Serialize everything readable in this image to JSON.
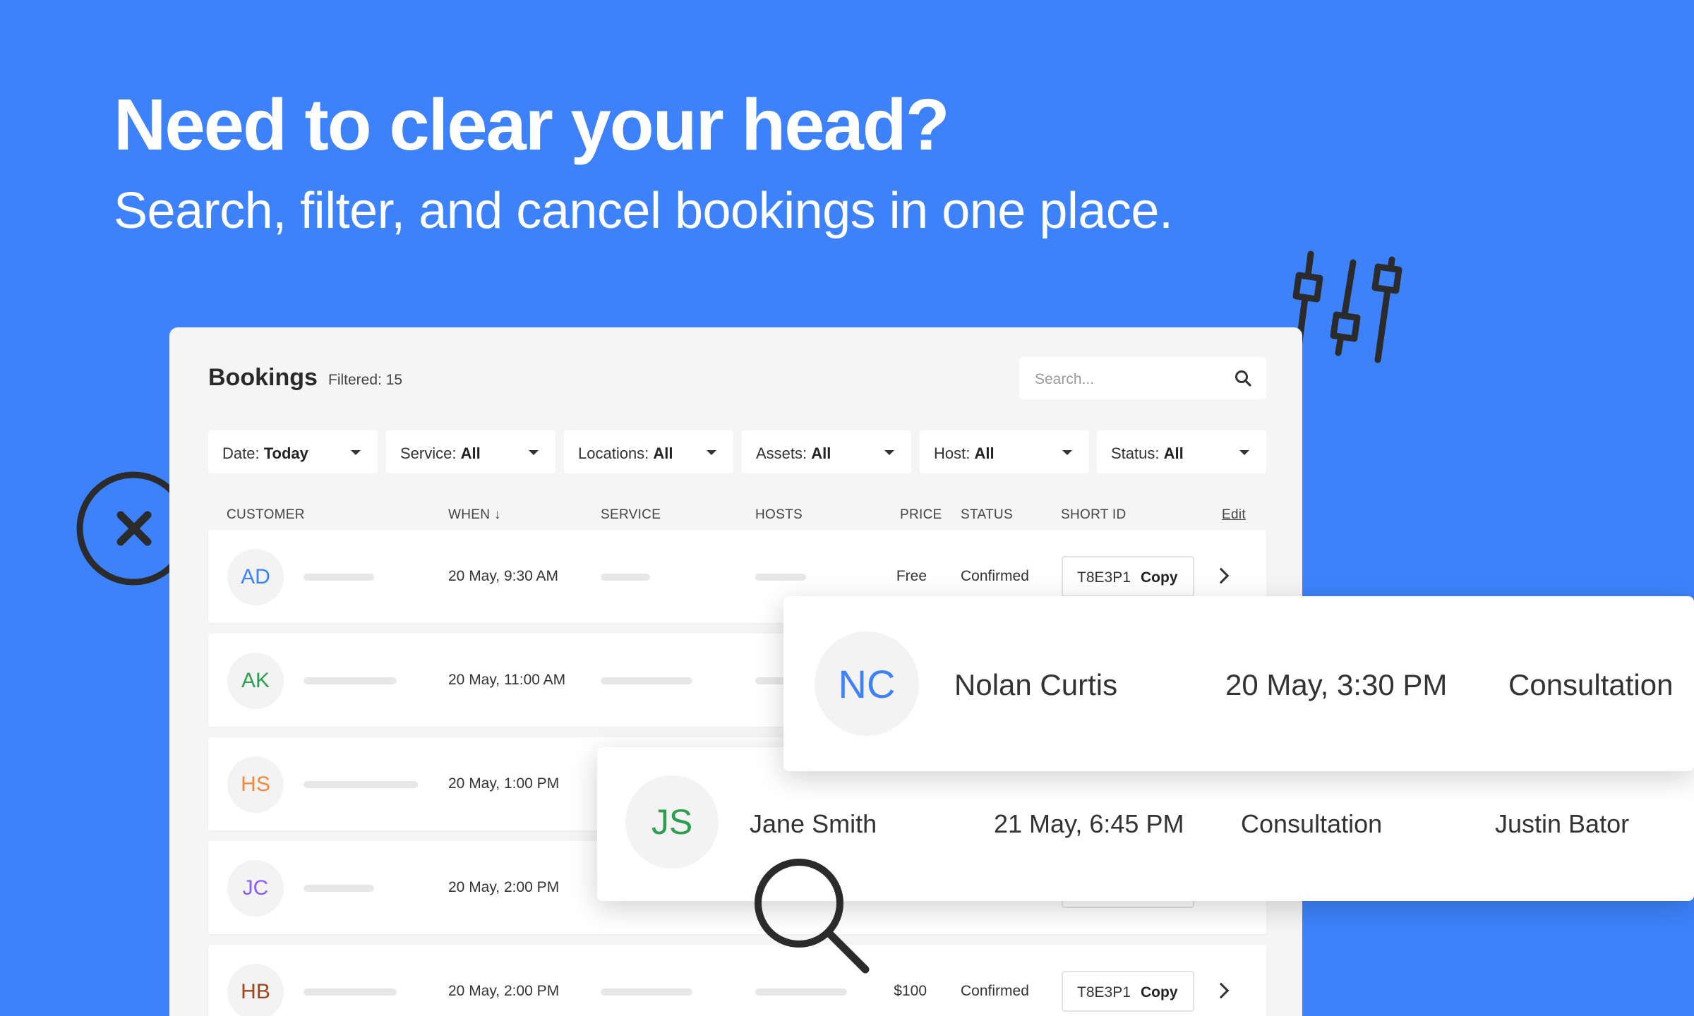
{
  "hero": {
    "title": "Need to clear your head?",
    "subtitle": "Search, filter, and cancel bookings in one place."
  },
  "panel": {
    "title": "Bookings",
    "filtered_label": "Filtered: 15",
    "search_placeholder": "Search..."
  },
  "filters": [
    {
      "label": "Date: ",
      "value": "Today"
    },
    {
      "label": "Service: ",
      "value": "All"
    },
    {
      "label": "Locations: ",
      "value": "All"
    },
    {
      "label": "Assets: ",
      "value": "All"
    },
    {
      "label": "Host: ",
      "value": "All"
    },
    {
      "label": "Status: ",
      "value": "All"
    }
  ],
  "columns": {
    "customer": "CUSTOMER",
    "when": "WHEN ↓",
    "service": "SERVICE",
    "hosts": "HOSTS",
    "price": "PRICE",
    "status": "STATUS",
    "short_id": "SHORT ID",
    "edit": "Edit"
  },
  "rows": [
    {
      "initials": "AD",
      "color": "#3d82fb",
      "when": "20 May, 9:30 AM",
      "price": "Free",
      "status": "Confirmed",
      "short_id": "T8E3P1",
      "copy": "Copy"
    },
    {
      "initials": "AK",
      "color": "#2e9e4f",
      "when": "20 May, 11:00 AM",
      "price": "",
      "status": "",
      "short_id": "",
      "copy": ""
    },
    {
      "initials": "HS",
      "color": "#f08a3c",
      "when": "20 May, 1:00 PM",
      "price": "",
      "status": "",
      "short_id": "",
      "copy": ""
    },
    {
      "initials": "JC",
      "color": "#8b5cf6",
      "when": "20 May, 2:00 PM",
      "price": "",
      "status": "",
      "short_id": "",
      "copy": ""
    },
    {
      "initials": "HB",
      "color": "#a0441c",
      "when": "20 May, 2:00 PM",
      "price": "$100",
      "status": "Confirmed",
      "short_id": "T8E3P1",
      "copy": "Copy"
    }
  ],
  "card_nc": {
    "initials": "NC",
    "color": "#3d82fb",
    "name": "Nolan Curtis",
    "when": "20 May, 3:30 PM",
    "service": "Consultation"
  },
  "card_js": {
    "initials": "JS",
    "color": "#2e9e4f",
    "name": "Jane Smith",
    "when": "21 May, 6:45 PM",
    "service": "Consultation",
    "host": "Justin Bator"
  },
  "icons": {
    "cancel": "close-circle-icon",
    "filter": "sliders-icon",
    "search": "magnifier-icon"
  }
}
